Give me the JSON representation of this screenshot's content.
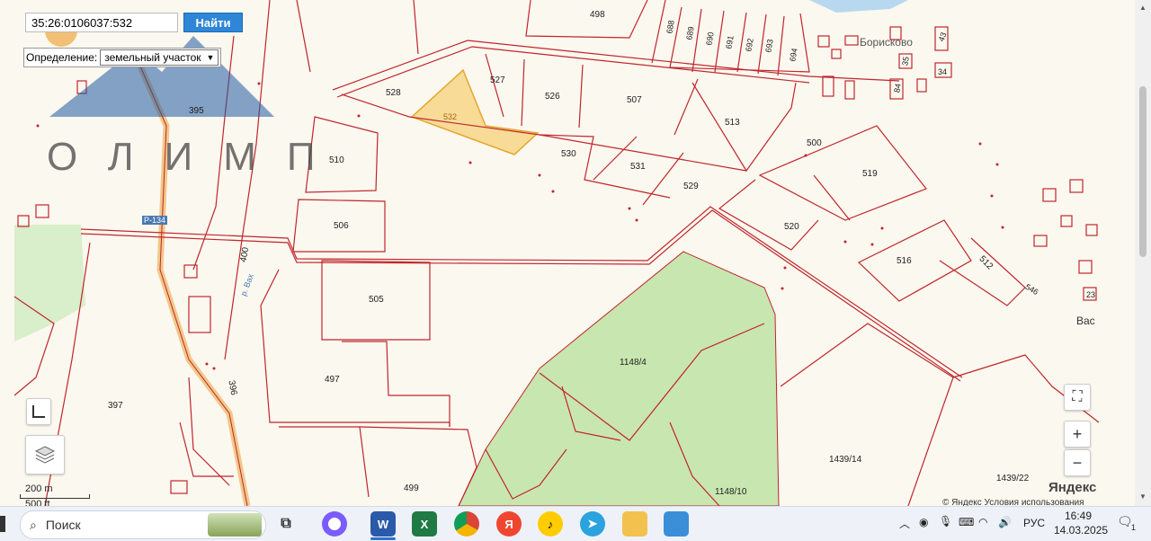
{
  "search": {
    "value": "35:26:0106037:532",
    "button_label": "Найти"
  },
  "definition": {
    "label": "Определение:",
    "selected": "земельный участок"
  },
  "watermark": {
    "text": "ОЛИМП"
  },
  "map": {
    "scale_metric": "200 m",
    "scale_imperial": "500 ft",
    "attribution": "© Яндекс  Условия использования",
    "logo": "Яндекс",
    "highway_label": "Р-134",
    "river_label": "р. Вах",
    "village_label": "Борисково",
    "edge_label": "Вас",
    "parcel_labels": [
      "498",
      "688",
      "689",
      "690",
      "691",
      "692",
      "693",
      "694",
      "395",
      "528",
      "527",
      "526",
      "507",
      "532",
      "513",
      "510",
      "530",
      "531",
      "529",
      "500",
      "519",
      "506",
      "520",
      "400",
      "516",
      "512",
      "546",
      "505",
      "1148/4",
      "497",
      "397",
      "396",
      "1439/14",
      "1439/22",
      "499",
      "1148/10",
      "43",
      "35",
      "34",
      "84",
      "23"
    ],
    "selected_parcel": "532"
  },
  "controls": {
    "zoom_in": "+",
    "zoom_out": "−"
  },
  "taskbar": {
    "search_placeholder": "Поиск",
    "language": "РУС",
    "time": "16:49",
    "date": "14.03.2025",
    "notifications": "1",
    "apps": [
      {
        "name": "task-view-icon",
        "label": ""
      },
      {
        "name": "alice-icon",
        "label": ""
      },
      {
        "name": "word-icon",
        "label": "W"
      },
      {
        "name": "excel-icon",
        "label": "X"
      },
      {
        "name": "chrome-icon",
        "label": ""
      },
      {
        "name": "yandex-browser-icon",
        "label": "Я"
      },
      {
        "name": "yandex-music-icon",
        "label": ""
      },
      {
        "name": "telegram-icon",
        "label": ""
      },
      {
        "name": "file-explorer-icon",
        "label": ""
      },
      {
        "name": "photos-icon",
        "label": ""
      }
    ]
  },
  "colors": {
    "accent": "#2f86d6",
    "parcel_line": "#c0262d",
    "forest": "#c8e6b0",
    "selected": "#f5d27a"
  }
}
